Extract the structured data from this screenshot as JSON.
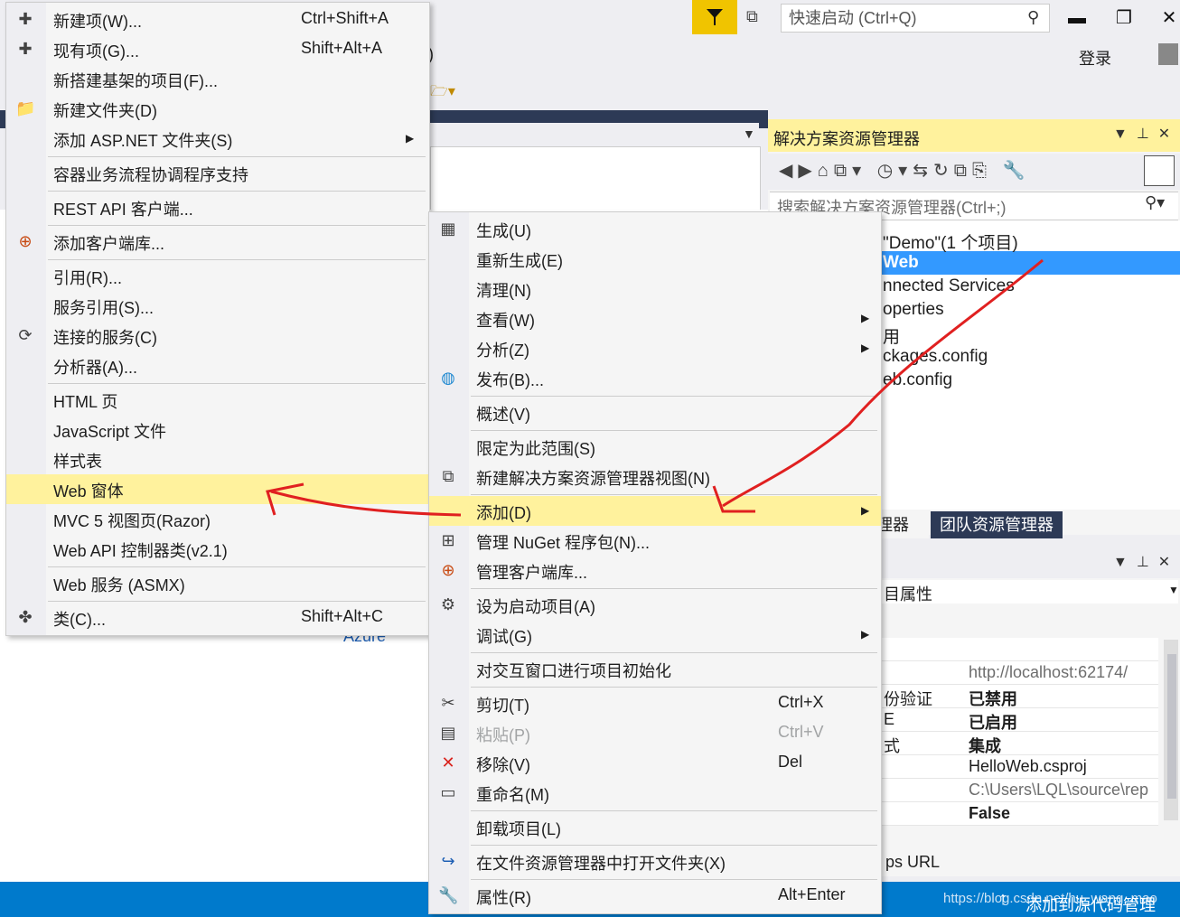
{
  "titlebar": {
    "quick_launch_placeholder": "快速启动 (Ctrl+Q)",
    "login": "登录",
    "menu_fragment": ")",
    "minimize": "▬",
    "restore": "❐",
    "close": "✕"
  },
  "editor": {
    "azure_fragment": "Azure"
  },
  "solution_explorer": {
    "title": "解决方案资源管理器",
    "search_placeholder": "搜索解决方案资源管理器(Ctrl+;)",
    "tree": [
      "\"Demo\"(1 个项目)",
      "Web",
      "nnected Services",
      "operties",
      "用",
      "ckages.config",
      "eb.config"
    ],
    "tabs": [
      "理器",
      "团队资源管理器"
    ]
  },
  "properties": {
    "combo": "目属性",
    "rows": [
      {
        "name": "",
        "value": ""
      },
      {
        "name": "",
        "value": "http://localhost:62174/"
      },
      {
        "name": "份验证",
        "value": "已禁用"
      },
      {
        "name": "E",
        "value": "已启用"
      },
      {
        "name": "式",
        "value": "集成"
      },
      {
        "name": "",
        "value": "HelloWeb.csproj"
      },
      {
        "name": "",
        "value": "C:\\Users\\LQL\\source\\rep"
      },
      {
        "name": "",
        "value": "False"
      }
    ],
    "url_fragment": "ps URL"
  },
  "status": {
    "text": "添加到源代码管理",
    "watermark": "https://blog.csdn.net/hu_wang_mao"
  },
  "add_menu": {
    "items": [
      {
        "label": "新建项(W)...",
        "shortcut": "Ctrl+Shift+A",
        "icon": "new-item-icon"
      },
      {
        "label": "现有项(G)...",
        "shortcut": "Shift+Alt+A",
        "icon": "existing-item-icon"
      },
      {
        "label": "新搭建基架的项目(F)...",
        "shortcut": "",
        "icon": ""
      },
      {
        "label": "新建文件夹(D)",
        "shortcut": "",
        "icon": "new-folder-icon"
      },
      {
        "label": "添加 ASP.NET 文件夹(S)",
        "shortcut": "",
        "icon": ""
      },
      {
        "label": "容器业务流程协调程序支持",
        "shortcut": "",
        "icon": ""
      },
      {
        "label": "REST API 客户端...",
        "shortcut": "",
        "icon": ""
      },
      {
        "label": "添加客户端库...",
        "shortcut": "",
        "icon": "client-library-icon"
      },
      {
        "label": "引用(R)...",
        "shortcut": "",
        "icon": ""
      },
      {
        "label": "服务引用(S)...",
        "shortcut": "",
        "icon": ""
      },
      {
        "label": "连接的服务(C)",
        "shortcut": "",
        "icon": "connected-service-icon"
      },
      {
        "label": "分析器(A)...",
        "shortcut": "",
        "icon": ""
      },
      {
        "label": "HTML 页",
        "shortcut": "",
        "icon": ""
      },
      {
        "label": "JavaScript 文件",
        "shortcut": "",
        "icon": ""
      },
      {
        "label": "样式表",
        "shortcut": "",
        "icon": ""
      },
      {
        "label": "Web 窗体",
        "shortcut": "",
        "icon": ""
      },
      {
        "label": "MVC 5 视图页(Razor)",
        "shortcut": "",
        "icon": ""
      },
      {
        "label": "Web API 控制器类(v2.1)",
        "shortcut": "",
        "icon": ""
      },
      {
        "label": "Web 服务 (ASMX)",
        "shortcut": "",
        "icon": ""
      },
      {
        "label": "类(C)...",
        "shortcut": "Shift+Alt+C",
        "icon": "class-icon"
      }
    ]
  },
  "project_menu": {
    "items": [
      {
        "label": "生成(U)",
        "shortcut": "",
        "icon": "build-icon"
      },
      {
        "label": "重新生成(E)",
        "shortcut": "",
        "icon": ""
      },
      {
        "label": "清理(N)",
        "shortcut": "",
        "icon": ""
      },
      {
        "label": "查看(W)",
        "shortcut": "",
        "icon": ""
      },
      {
        "label": "分析(Z)",
        "shortcut": "",
        "icon": ""
      },
      {
        "label": "发布(B)...",
        "shortcut": "",
        "icon": "publish-icon"
      },
      {
        "label": "概述(V)",
        "shortcut": "",
        "icon": ""
      },
      {
        "label": "限定为此范围(S)",
        "shortcut": "",
        "icon": ""
      },
      {
        "label": "新建解决方案资源管理器视图(N)",
        "shortcut": "",
        "icon": "new-view-icon"
      },
      {
        "label": "添加(D)",
        "shortcut": "",
        "icon": ""
      },
      {
        "label": "管理 NuGet 程序包(N)...",
        "shortcut": "",
        "icon": "nuget-icon"
      },
      {
        "label": "管理客户端库...",
        "shortcut": "",
        "icon": "client-library-icon"
      },
      {
        "label": "设为启动项目(A)",
        "shortcut": "",
        "icon": "gear-icon"
      },
      {
        "label": "调试(G)",
        "shortcut": "",
        "icon": ""
      },
      {
        "label": "对交互窗口进行项目初始化",
        "shortcut": "",
        "icon": ""
      },
      {
        "label": "剪切(T)",
        "shortcut": "Ctrl+X",
        "icon": "cut-icon"
      },
      {
        "label": "粘贴(P)",
        "shortcut": "Ctrl+V",
        "icon": "paste-icon"
      },
      {
        "label": "移除(V)",
        "shortcut": "Del",
        "icon": "remove-icon"
      },
      {
        "label": "重命名(M)",
        "shortcut": "",
        "icon": "rename-icon"
      },
      {
        "label": "卸载项目(L)",
        "shortcut": "",
        "icon": ""
      },
      {
        "label": "在文件资源管理器中打开文件夹(X)",
        "shortcut": "",
        "icon": "open-folder-icon"
      },
      {
        "label": "属性(R)",
        "shortcut": "Alt+Enter",
        "icon": "wrench-icon"
      }
    ]
  },
  "colors": {
    "highlight": "#fff29d",
    "selection": "#3399ff",
    "statusbar": "#007acc",
    "annotation": "#e02020"
  }
}
